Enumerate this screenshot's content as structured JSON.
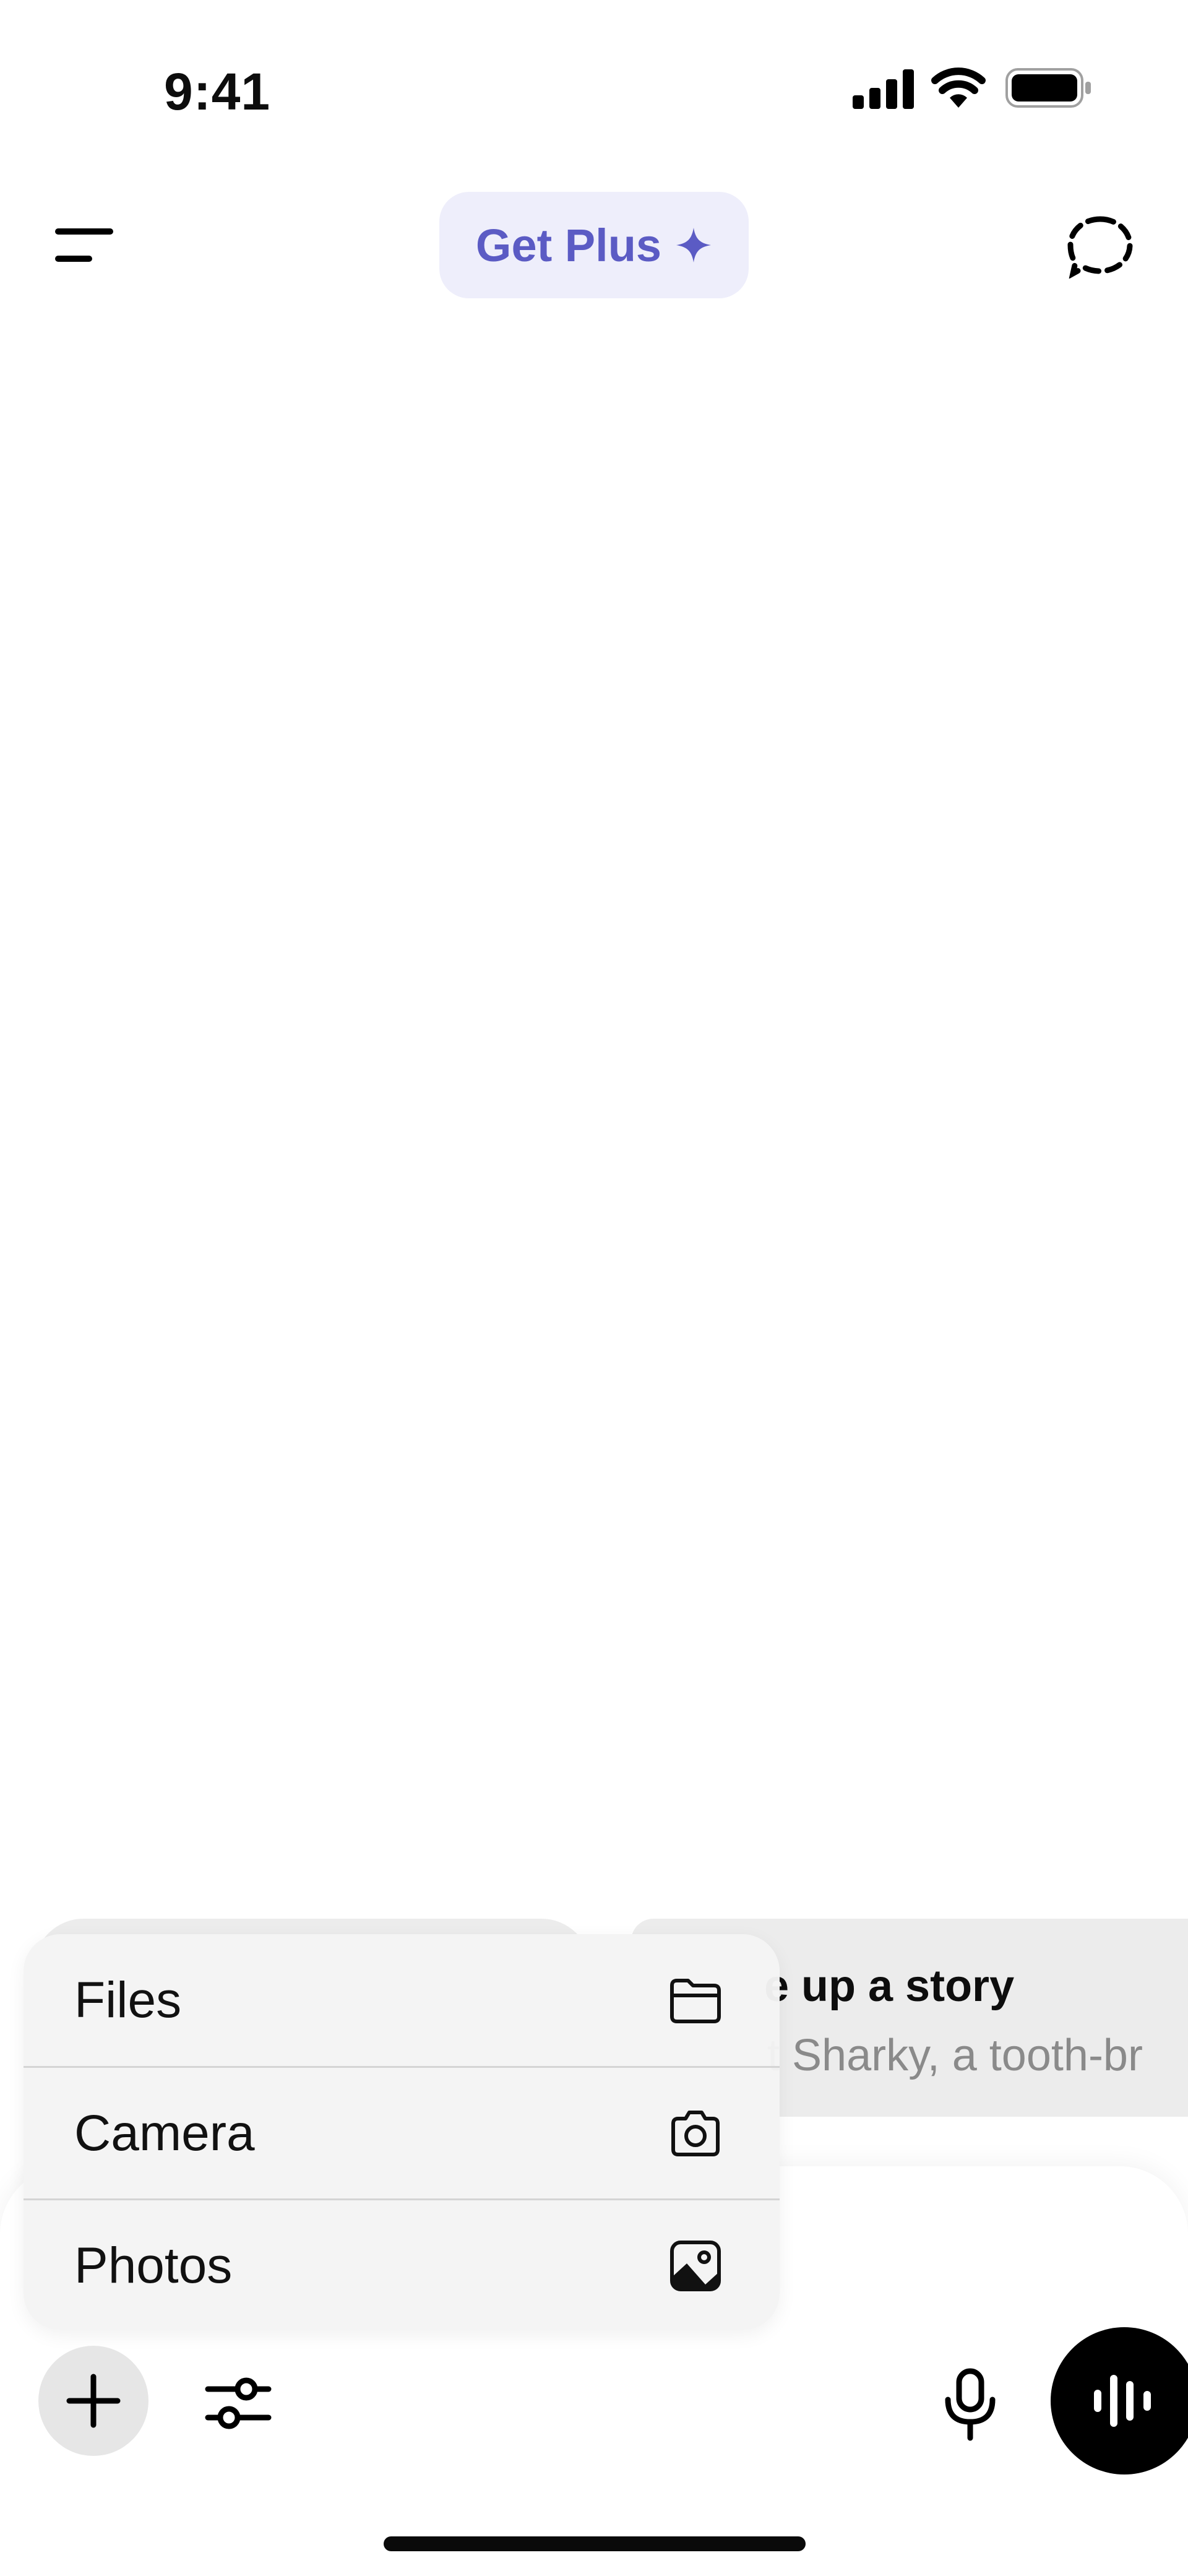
{
  "status_bar": {
    "time": "9:41"
  },
  "header": {
    "get_plus_label": "Get Plus",
    "menu_icon": "menu-icon",
    "new_chat_icon": "dashed-chat-bubble-icon"
  },
  "suggestion": {
    "title": "e up a story",
    "subtitle": "t Sharky, a tooth-br"
  },
  "attach_menu": {
    "items": [
      {
        "label": "Files",
        "icon": "folder-icon"
      },
      {
        "label": "Camera",
        "icon": "camera-icon"
      },
      {
        "label": "Photos",
        "icon": "photos-icon"
      }
    ]
  },
  "toolbar": {
    "plus_icon": "plus-icon",
    "tools_icon": "sliders-icon",
    "mic_icon": "microphone-icon",
    "voice_icon": "voice-waveform-icon"
  },
  "colors": {
    "accent_purple": "#5b5bc4",
    "get_plus_bg": "#eeeefb",
    "voice_button": "#000000"
  }
}
